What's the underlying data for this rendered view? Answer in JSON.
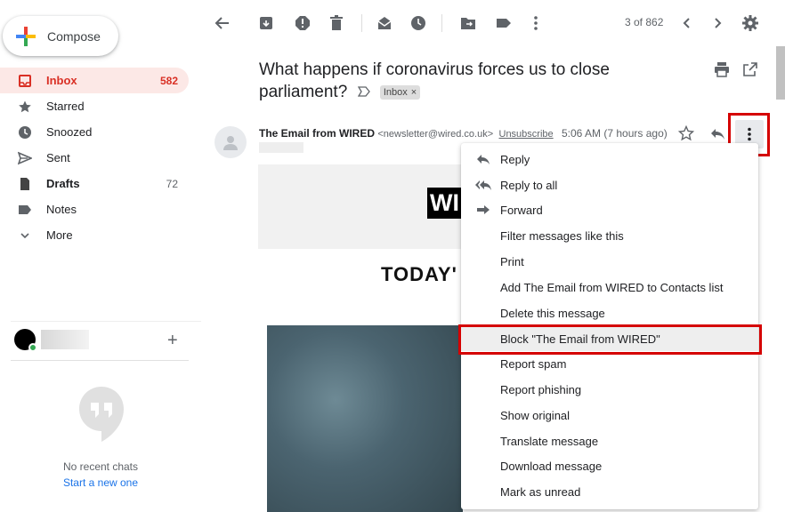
{
  "sidebar": {
    "compose_label": "Compose",
    "items": [
      {
        "label": "Inbox",
        "count": "582",
        "icon": "inbox-icon"
      },
      {
        "label": "Starred",
        "count": "",
        "icon": "star-icon"
      },
      {
        "label": "Snoozed",
        "count": "",
        "icon": "clock-icon"
      },
      {
        "label": "Sent",
        "count": "",
        "icon": "send-icon"
      },
      {
        "label": "Drafts",
        "count": "72",
        "icon": "draft-icon"
      },
      {
        "label": "Notes",
        "count": "",
        "icon": "label-icon"
      },
      {
        "label": "More",
        "count": "",
        "icon": "chevron-down-icon"
      }
    ],
    "chat": {
      "no_chats": "No recent chats",
      "start_new": "Start a new one"
    }
  },
  "toolbar": {
    "pager": "3 of 862"
  },
  "message": {
    "subject": "What happens if coronavirus forces us to close parliament?",
    "label_chip": "Inbox",
    "sender_name": "The Email from WIRED",
    "sender_email": "<newsletter@wired.co.uk>",
    "unsubscribe": "Unsubscribe",
    "time": "5:06 AM (7 hours ago)",
    "body_logo": "WI",
    "body_heading": "TODAY'"
  },
  "menu": {
    "items": [
      {
        "label": "Reply",
        "icon": "reply-icon"
      },
      {
        "label": "Reply to all",
        "icon": "reply-all-icon"
      },
      {
        "label": "Forward",
        "icon": "forward-icon"
      },
      {
        "label": "Filter messages like this",
        "icon": ""
      },
      {
        "label": "Print",
        "icon": ""
      },
      {
        "label": "Add The Email from WIRED to Contacts list",
        "icon": ""
      },
      {
        "label": "Delete this message",
        "icon": ""
      },
      {
        "label": "Block \"The Email from WIRED\"",
        "icon": ""
      },
      {
        "label": "Report spam",
        "icon": ""
      },
      {
        "label": "Report phishing",
        "icon": ""
      },
      {
        "label": "Show original",
        "icon": ""
      },
      {
        "label": "Translate message",
        "icon": ""
      },
      {
        "label": "Download message",
        "icon": ""
      },
      {
        "label": "Mark as unread",
        "icon": ""
      }
    ]
  },
  "colors": {
    "accent_red": "#d93025",
    "highlight_box": "#d50000",
    "link_blue": "#1a73e8"
  }
}
